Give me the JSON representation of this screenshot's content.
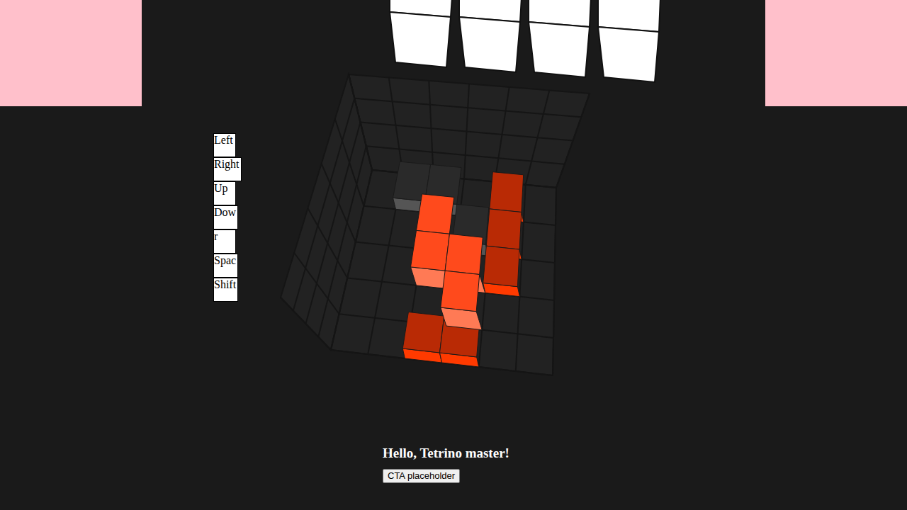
{
  "controls": [
    {
      "label": "Left"
    },
    {
      "label": "Right"
    },
    {
      "label": "Up"
    },
    {
      "label": "Dow"
    },
    {
      "label": "r"
    },
    {
      "label": "Spac"
    },
    {
      "label": "Shift"
    }
  ],
  "preview": {
    "blocks": [
      {
        "col": 0
      },
      {
        "col": 1
      },
      {
        "col": 2
      },
      {
        "col": 3
      }
    ]
  },
  "well": {
    "columns": 6,
    "rows": 5,
    "blocks": [
      {
        "col": 1,
        "row": 0,
        "kind": "dark"
      },
      {
        "col": 2,
        "row": 0,
        "kind": "dark"
      },
      {
        "col": 3,
        "row": 1,
        "kind": "dark"
      },
      {
        "col": 4,
        "row": 0,
        "kind": "settled"
      },
      {
        "col": 4,
        "row": 1,
        "kind": "settled"
      },
      {
        "col": 4,
        "row": 2,
        "kind": "settled"
      },
      {
        "col": 2,
        "row": 4,
        "kind": "settled"
      },
      {
        "col": 3,
        "row": 4,
        "kind": "settled"
      },
      {
        "col": 2,
        "row": 1,
        "kind": "falling"
      },
      {
        "col": 2,
        "row": 2,
        "kind": "falling"
      },
      {
        "col": 3,
        "row": 2,
        "kind": "falling"
      },
      {
        "col": 3,
        "row": 3,
        "kind": "falling"
      }
    ]
  },
  "message": "Hello, Tetrino master!",
  "cta": "CTA placeholder"
}
